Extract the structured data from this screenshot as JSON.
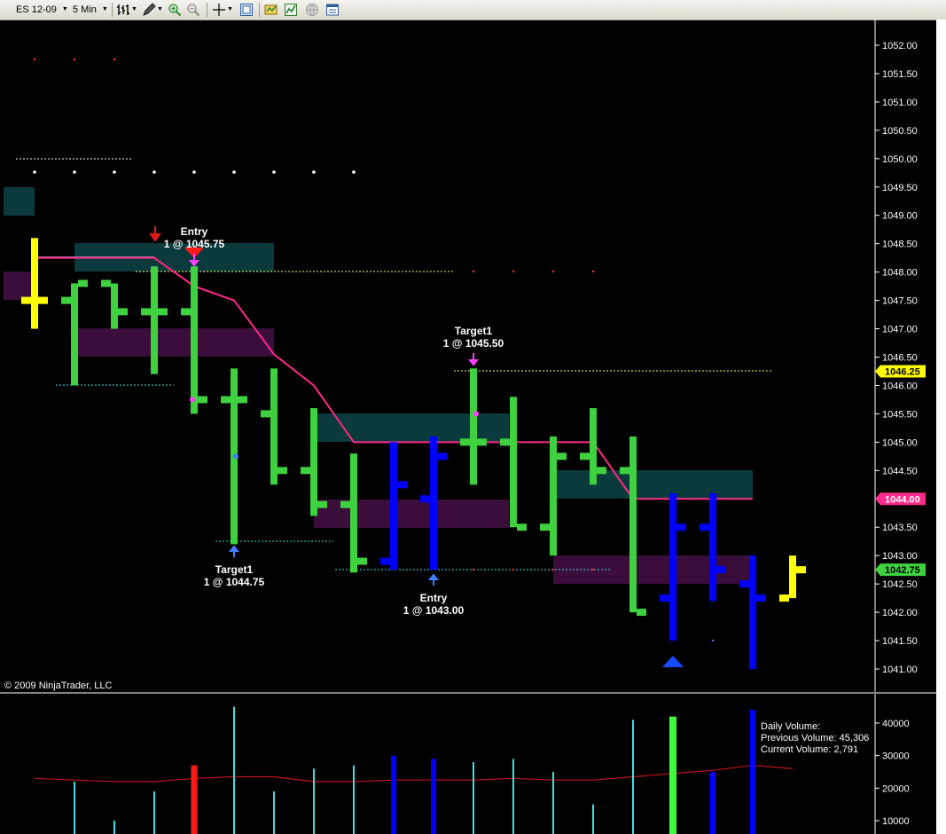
{
  "toolbar": {
    "instrument": "ES 12-09",
    "interval": "5 Min",
    "icons": [
      "bar-type-icon",
      "draw-pencil-icon",
      "zoom-in-icon",
      "zoom-out-icon",
      "crosshair-icon",
      "chart-properties-icon",
      "indicators-icon",
      "strategies-icon",
      "globe-icon",
      "data-box-icon"
    ]
  },
  "copyright": "© 2009 NinjaTrader, LLC",
  "colors": {
    "up_bar": "#3fd13f",
    "down_bar": "#0000ff",
    "current_bar": "#ffff00",
    "trend_line": "#ff2a8a",
    "teal_zone": "#0b3a3c",
    "purple_zone": "#3a0d3a"
  },
  "chart_data": {
    "type": "bar",
    "price_axis": {
      "ticks": [
        "1052.00",
        "1051.50",
        "1051.00",
        "1050.50",
        "1050.00",
        "1049.50",
        "1049.00",
        "1048.50",
        "1048.00",
        "1047.50",
        "1047.00",
        "1046.50",
        "1046.00",
        "1045.50",
        "1045.00",
        "1044.50",
        "1044.00",
        "1043.50",
        "1043.00",
        "1042.50",
        "1042.00",
        "1041.50",
        "1041.00"
      ],
      "range": [
        1040.6,
        1052.3
      ],
      "markers": [
        {
          "label": "1046.25",
          "value": 1046.25,
          "color": "#ffff00",
          "text_color": "#000"
        },
        {
          "label": "1044.00",
          "value": 1044.0,
          "color": "#ff2a8a",
          "text_color": "#fff"
        },
        {
          "label": "1042.75",
          "value": 1042.75,
          "color": "#3fd13f",
          "text_color": "#000"
        }
      ]
    },
    "bars": [
      {
        "o": 1047.5,
        "h": 1048.6,
        "l": 1047.0,
        "c": 1047.5,
        "color": "yellow"
      },
      {
        "o": 1047.5,
        "h": 1047.8,
        "l": 1046.0,
        "c": 1047.8,
        "color": "green"
      },
      {
        "o": 1047.8,
        "h": 1047.8,
        "l": 1047.0,
        "c": 1047.3,
        "color": "green"
      },
      {
        "o": 1047.3,
        "h": 1048.1,
        "l": 1046.2,
        "c": 1047.3,
        "color": "green"
      },
      {
        "o": 1047.3,
        "h": 1048.1,
        "l": 1045.5,
        "c": 1045.75,
        "color": "green"
      },
      {
        "o": 1045.75,
        "h": 1046.3,
        "l": 1043.2,
        "c": 1045.75,
        "color": "green"
      },
      {
        "o": 1045.5,
        "h": 1046.3,
        "l": 1044.25,
        "c": 1044.5,
        "color": "green"
      },
      {
        "o": 1044.5,
        "h": 1045.6,
        "l": 1043.7,
        "c": 1043.9,
        "color": "green"
      },
      {
        "o": 1043.9,
        "h": 1044.8,
        "l": 1042.7,
        "c": 1042.9,
        "color": "green"
      },
      {
        "o": 1042.9,
        "h": 1045.0,
        "l": 1042.75,
        "c": 1044.25,
        "color": "blue"
      },
      {
        "o": 1044.0,
        "h": 1045.1,
        "l": 1042.75,
        "c": 1044.75,
        "color": "blue"
      },
      {
        "o": 1045.0,
        "h": 1046.3,
        "l": 1044.25,
        "c": 1045.0,
        "color": "green"
      },
      {
        "o": 1045.0,
        "h": 1045.8,
        "l": 1043.5,
        "c": 1043.5,
        "color": "green"
      },
      {
        "o": 1043.5,
        "h": 1045.1,
        "l": 1043.0,
        "c": 1044.75,
        "color": "green"
      },
      {
        "o": 1044.75,
        "h": 1045.6,
        "l": 1044.25,
        "c": 1044.5,
        "color": "green"
      },
      {
        "o": 1044.5,
        "h": 1045.1,
        "l": 1042.0,
        "c": 1042.0,
        "color": "green"
      },
      {
        "o": 1042.25,
        "h": 1044.1,
        "l": 1041.5,
        "c": 1043.5,
        "color": "blue"
      },
      {
        "o": 1043.5,
        "h": 1044.1,
        "l": 1042.2,
        "c": 1042.75,
        "color": "blue"
      },
      {
        "o": 1042.5,
        "h": 1043.0,
        "l": 1041.0,
        "c": 1042.25,
        "color": "blue"
      },
      {
        "o": 1042.25,
        "h": 1043.0,
        "l": 1042.25,
        "c": 1042.75,
        "color": "yellow_current"
      }
    ],
    "trend_line": [
      1048.25,
      1048.25,
      1048.25,
      1048.25,
      1047.75,
      1047.5,
      1046.55,
      1046.0,
      1045.0,
      1045.0,
      1045.0,
      1045.0,
      1045.0,
      1045.0,
      1045.0,
      1044.0,
      1044.0,
      1044.0,
      1044.0
    ],
    "annotations": [
      {
        "label": "Entry",
        "sub": "1 @ 1045.75",
        "bar": 4,
        "position": "above"
      },
      {
        "label": "Target1",
        "sub": "1 @ 1044.75",
        "bar": 5,
        "position": "below"
      },
      {
        "label": "Target1",
        "sub": "1 @ 1045.50",
        "bar": 11,
        "position": "above"
      },
      {
        "label": "Entry",
        "sub": "1 @ 1043.00",
        "bar": 10,
        "position": "below"
      }
    ],
    "volume_panel": {
      "ticks": [
        "40000",
        "30000",
        "20000",
        "10000"
      ],
      "range": [
        5000,
        44000
      ],
      "info": [
        "Daily Volume:",
        "Previous Volume: 45,306",
        "Current Volume: 2,791"
      ],
      "values": [
        4000,
        22000,
        10000,
        19000,
        27000,
        45000,
        19000,
        26000,
        27000,
        30000,
        29000,
        28000,
        29000,
        25000,
        15000,
        41000,
        42000,
        25000,
        44000
      ],
      "average": [
        23000,
        22500,
        22000,
        22000,
        23000,
        23500,
        23500,
        22000,
        22000,
        22500,
        22500,
        22500,
        23000,
        22500,
        22500,
        23500,
        24500,
        25500,
        27000,
        26000
      ]
    }
  }
}
